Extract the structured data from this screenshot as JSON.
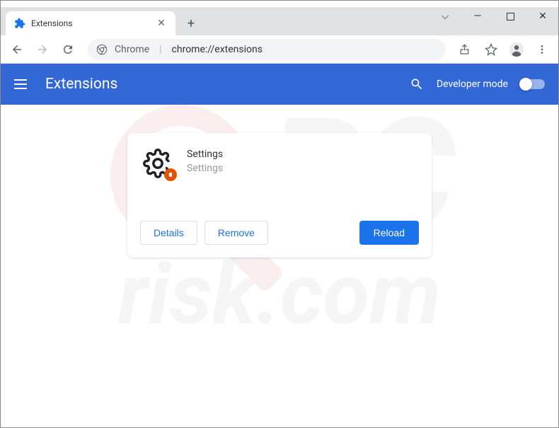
{
  "window": {
    "minimize": "—",
    "maximize": "▢",
    "close": "✕",
    "dropdown": "⌵"
  },
  "tab": {
    "title": "Extensions",
    "close": "✕"
  },
  "toolbar": {
    "url_prefix": "Chrome",
    "url_path": "chrome://extensions"
  },
  "ext_header": {
    "title": "Extensions",
    "dev_mode_label": "Developer mode"
  },
  "card": {
    "name": "Settings",
    "description": "Settings",
    "details_label": "Details",
    "remove_label": "Remove",
    "reload_label": "Reload"
  },
  "watermark": {
    "big": "PC",
    "small": "risk.com"
  }
}
